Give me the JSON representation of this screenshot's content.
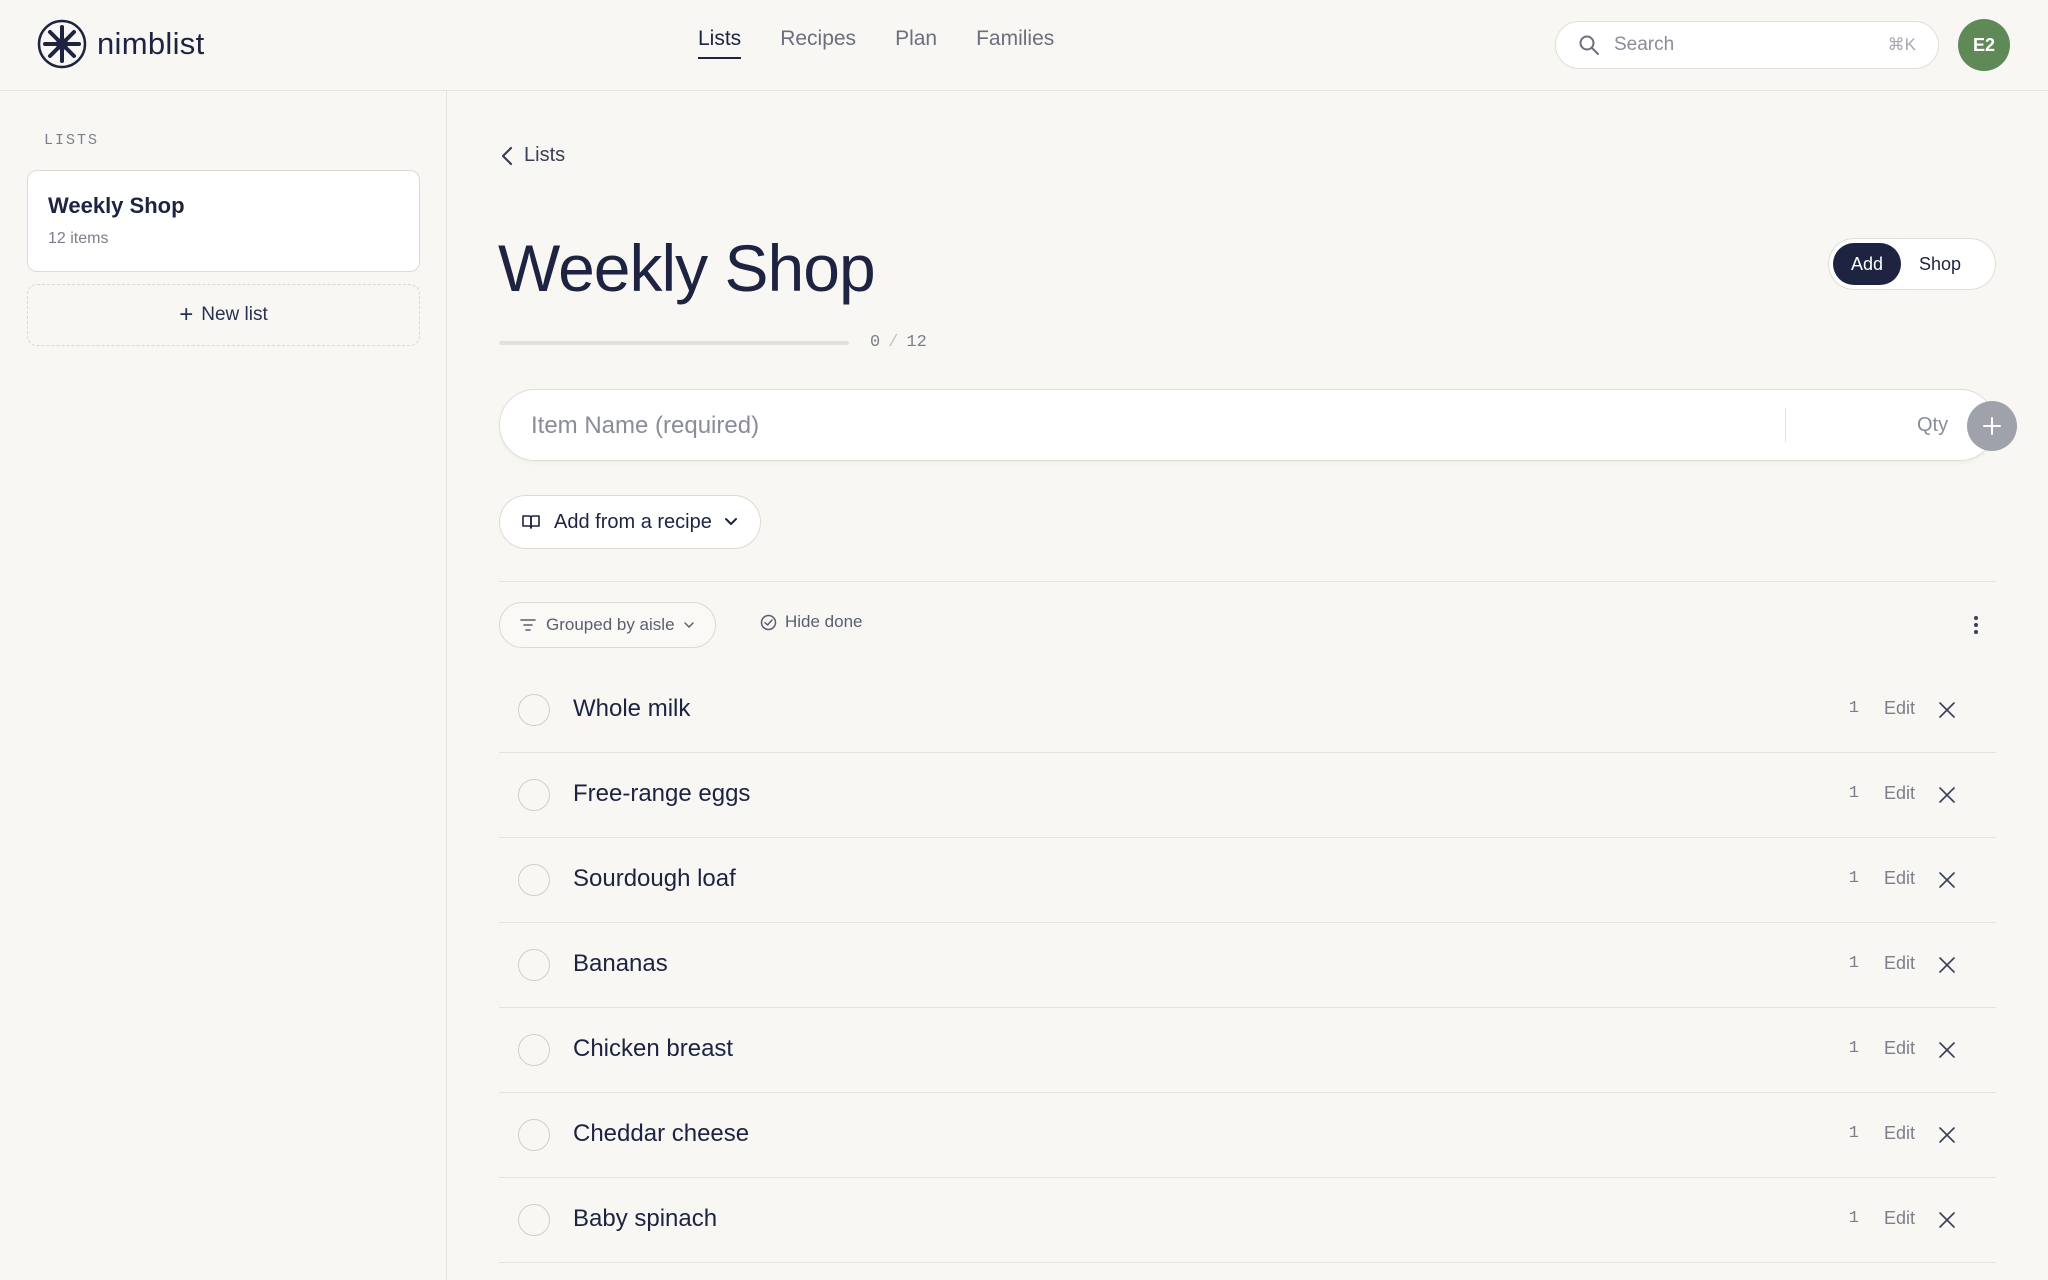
{
  "app": {
    "name": "nimblist"
  },
  "nav": {
    "items": [
      {
        "label": "Lists",
        "active": true
      },
      {
        "label": "Recipes",
        "active": false
      },
      {
        "label": "Plan",
        "active": false
      },
      {
        "label": "Families",
        "active": false
      }
    ]
  },
  "search": {
    "placeholder": "Search",
    "shortcut": "⌘K"
  },
  "user": {
    "initials": "E2",
    "avatar_color": "#5f8a58"
  },
  "sidebar": {
    "heading": "LISTS",
    "lists": [
      {
        "name": "Weekly Shop",
        "count": "12 items"
      }
    ],
    "new_list_label": "New list"
  },
  "main": {
    "back_label": "Lists",
    "title": "Weekly Shop",
    "mode": {
      "add_label": "Add",
      "shop_label": "Shop",
      "active": "Add"
    },
    "progress": {
      "done": "0",
      "separator": "/",
      "total": "12",
      "fraction": 0
    },
    "add_item": {
      "placeholder": "Item Name (required)",
      "qty_label": "Qty"
    },
    "recipe_button_label": "Add from a recipe",
    "grouping_label": "Grouped by aisle",
    "hide_done_label": "Hide done",
    "items": [
      {
        "name": "Whole milk",
        "qty": "1",
        "edit": "Edit"
      },
      {
        "name": "Free-range eggs",
        "qty": "1",
        "edit": "Edit"
      },
      {
        "name": "Sourdough loaf",
        "qty": "1",
        "edit": "Edit"
      },
      {
        "name": "Bananas",
        "qty": "1",
        "edit": "Edit"
      },
      {
        "name": "Chicken breast",
        "qty": "1",
        "edit": "Edit"
      },
      {
        "name": "Cheddar cheese",
        "qty": "1",
        "edit": "Edit"
      },
      {
        "name": "Baby spinach",
        "qty": "1",
        "edit": "Edit"
      }
    ]
  },
  "colors": {
    "primary": "#1d2340",
    "background": "#f8f7f4",
    "muted": "#7c7f8a"
  }
}
